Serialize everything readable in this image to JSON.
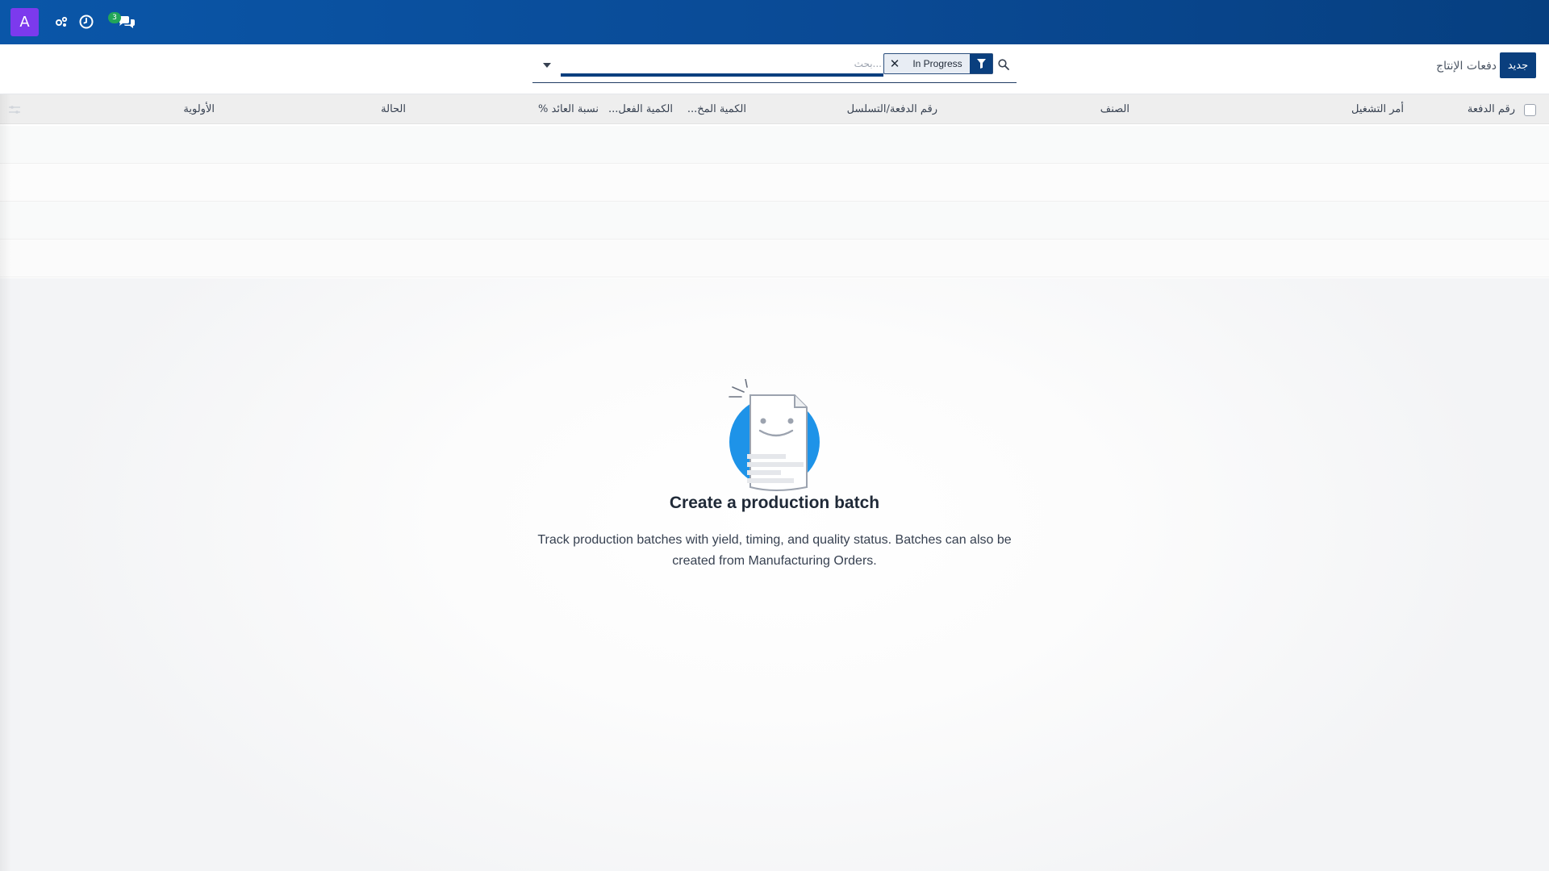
{
  "navbar": {
    "avatar_letter": "A",
    "icons": [
      "activity-icon",
      "clock-icon",
      "chat-icon"
    ],
    "messages_badge": "3",
    "colors": {
      "bar": "#0a4a95",
      "avatar": "#7c3aed",
      "badge": "#22a559"
    }
  },
  "control_panel": {
    "new_button_label": "جديد",
    "page_title": "دفعات الإنتاج",
    "search": {
      "placeholder": "بحث...",
      "facet_value": "In Progress"
    }
  },
  "list": {
    "columns": {
      "batch_number": "رقم الدفعة",
      "work_order": "أمر التشغيل",
      "item": "الصنف",
      "lot_serial": "رقم الدفعة/التسلسل",
      "planned_qty": "الكمية المخ...",
      "actual_qty": "الكمية الفعل...",
      "yield_pct": "نسبة العائد %",
      "status": "الحالة",
      "priority": "الأولوية"
    }
  },
  "empty_state": {
    "title": "Create a production batch",
    "text": "Track production batches with yield, timing, and quality status. Batches can also be created from Manufacturing Orders."
  },
  "colors": {
    "primary": "#0a3f7e",
    "header_bg": "#eeeeee"
  }
}
